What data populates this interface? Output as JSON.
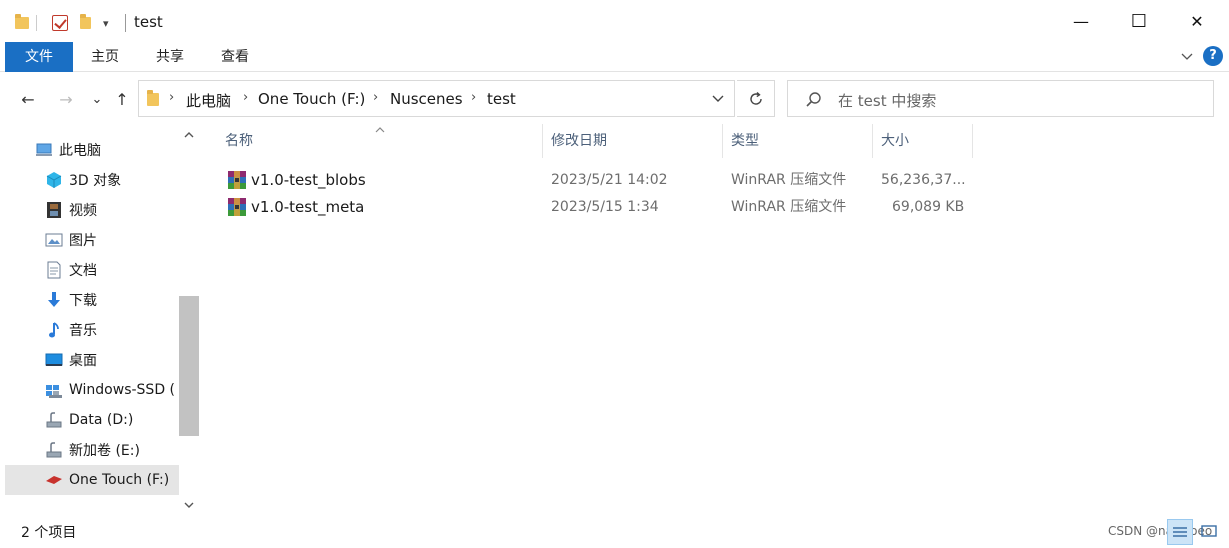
{
  "window": {
    "title": "test",
    "minimize_glyph": "—",
    "maximize_glyph": "☐",
    "close_glyph": "✕"
  },
  "quick_access": {
    "dropdown_glyph": "▾"
  },
  "ribbon": {
    "tabs": [
      {
        "label": "文件"
      },
      {
        "label": "主页"
      },
      {
        "label": "共享"
      },
      {
        "label": "查看"
      }
    ],
    "help_label": "?"
  },
  "navigation": {
    "back_glyph": "←",
    "forward_glyph": "→",
    "recent_glyph": "⌄",
    "up_glyph": "↑",
    "address": [
      "此电脑",
      "One Touch (F:)",
      "Nuscenes",
      "test"
    ],
    "separator_glyph": "›",
    "search_placeholder": "在 test 中搜索"
  },
  "sidebar": {
    "items": [
      {
        "label": "此电脑",
        "icon": "computer-icon"
      },
      {
        "label": "3D 对象",
        "icon": "cube-icon"
      },
      {
        "label": "视频",
        "icon": "film-icon"
      },
      {
        "label": "图片",
        "icon": "picture-icon"
      },
      {
        "label": "文档",
        "icon": "document-icon"
      },
      {
        "label": "下载",
        "icon": "download-icon"
      },
      {
        "label": "音乐",
        "icon": "music-icon"
      },
      {
        "label": "桌面",
        "icon": "desktop-icon"
      },
      {
        "label": "Windows-SSD (",
        "icon": "system-drive-icon"
      },
      {
        "label": "Data (D:)",
        "icon": "drive-icon"
      },
      {
        "label": "新加卷 (E:)",
        "icon": "drive-icon"
      },
      {
        "label": "One Touch (F:)",
        "icon": "external-drive-icon",
        "selected": true
      }
    ]
  },
  "file_list": {
    "columns": [
      "名称",
      "修改日期",
      "类型",
      "大小"
    ],
    "rows": [
      {
        "name": "v1.0-test_blobs",
        "modified": "2023/5/21 14:02",
        "type": "WinRAR 压缩文件",
        "size": "56,236,37..."
      },
      {
        "name": "v1.0-test_meta",
        "modified": "2023/5/15 1:34",
        "type": "WinRAR 压缩文件",
        "size": "69,089 KB"
      }
    ]
  },
  "status": {
    "item_count": "2 个项目",
    "watermark": "CSDN @nahisoeo"
  },
  "colors": {
    "accent": "#1a6fc4",
    "selected_bg": "#e5e5e5",
    "header_text": "#4c607a"
  }
}
